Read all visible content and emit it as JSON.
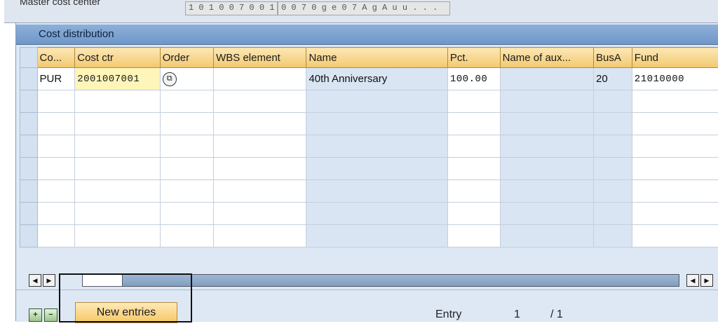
{
  "top": {
    "label": "Master cost center",
    "field1": "1 0 1 0 0 7 0 0 1",
    "field2": "0 0 7 0 g e   0 7   A g   A u u . . ."
  },
  "panel": {
    "title": "Cost distribution"
  },
  "columns": [
    "Co...",
    "Cost ctr",
    "Order",
    "WBS element",
    "Name",
    "Pct.",
    "Name of aux...",
    "BusA",
    "Fund"
  ],
  "rows": [
    {
      "co": "PUR",
      "cost_ctr": "2001007001",
      "order_help_icon": "f4-value-help-icon",
      "wbs": "",
      "name": "40th Anniversary",
      "pct": "100.00",
      "aux": "",
      "busa": "20",
      "fund": "21010000"
    }
  ],
  "scroll": {
    "left_arrow": "◀",
    "right_arrow": "▶"
  },
  "footer": {
    "insert_icon": "insert-row-icon",
    "delete_icon": "delete-row-icon",
    "new_entries_label": "New entries",
    "entry_label": "Entry",
    "entry_current": "1",
    "entry_total": "/ 1"
  }
}
